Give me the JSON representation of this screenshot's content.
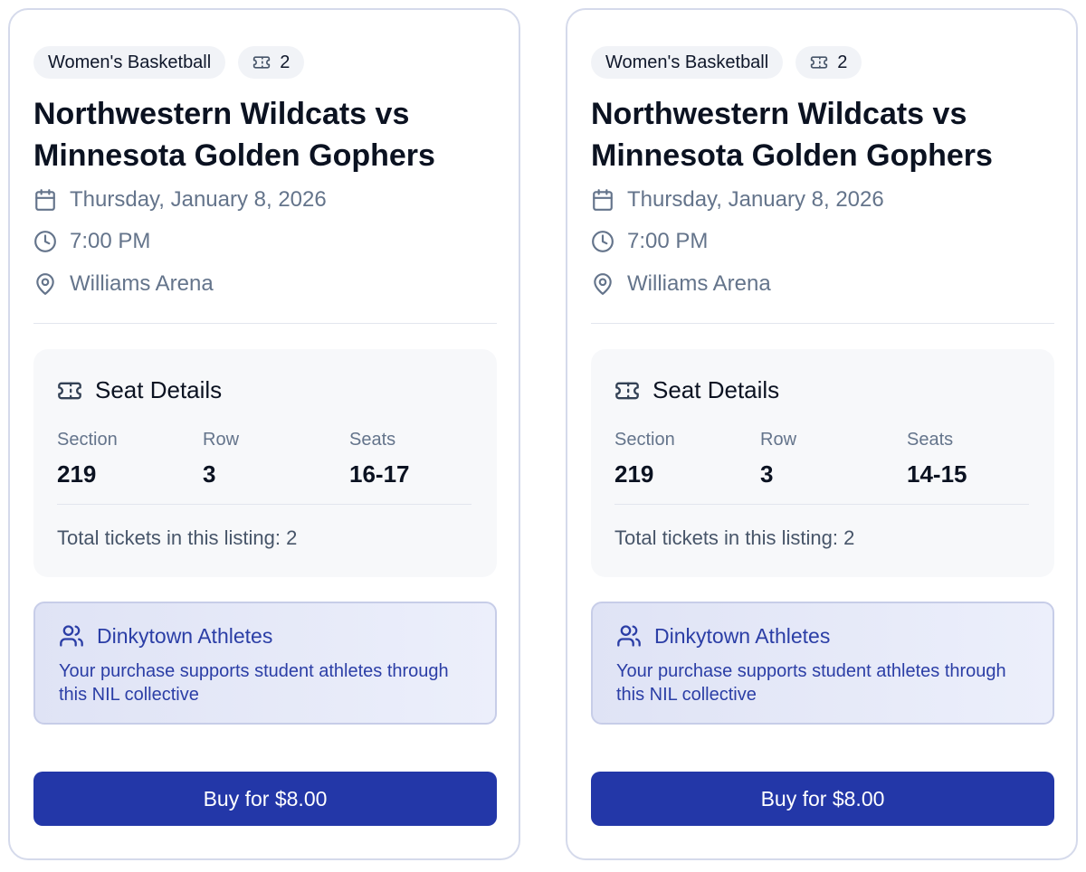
{
  "cards": [
    {
      "category": "Women's Basketball",
      "ticket_count": "2",
      "title": "Northwestern Wildcats vs Minnesota Golden Gophers",
      "date": "Thursday, January 8, 2026",
      "time": "7:00 PM",
      "venue": "Williams Arena",
      "seat_details_title": "Seat Details",
      "section_label": "Section",
      "section_value": "219",
      "row_label": "Row",
      "row_value": "3",
      "seats_label": "Seats",
      "seats_value": "16-17",
      "total_text": "Total tickets in this listing: 2",
      "collective_name": "Dinkytown Athletes",
      "collective_text": "Your purchase supports student athletes through this NIL collective",
      "buy_label": "Buy for $8.00"
    },
    {
      "category": "Women's Basketball",
      "ticket_count": "2",
      "title": "Northwestern Wildcats vs Minnesota Golden Gophers",
      "date": "Thursday, January 8, 2026",
      "time": "7:00 PM",
      "venue": "Williams Arena",
      "seat_details_title": "Seat Details",
      "section_label": "Section",
      "section_value": "219",
      "row_label": "Row",
      "row_value": "3",
      "seats_label": "Seats",
      "seats_value": "14-15",
      "total_text": "Total tickets in this listing: 2",
      "collective_name": "Dinkytown Athletes",
      "collective_text": "Your purchase supports student athletes through this NIL collective",
      "buy_label": "Buy for $8.00"
    }
  ],
  "colors": {
    "accent": "#2337a8",
    "muted_text": "#64748b",
    "nil_text": "#2b3ea6"
  }
}
